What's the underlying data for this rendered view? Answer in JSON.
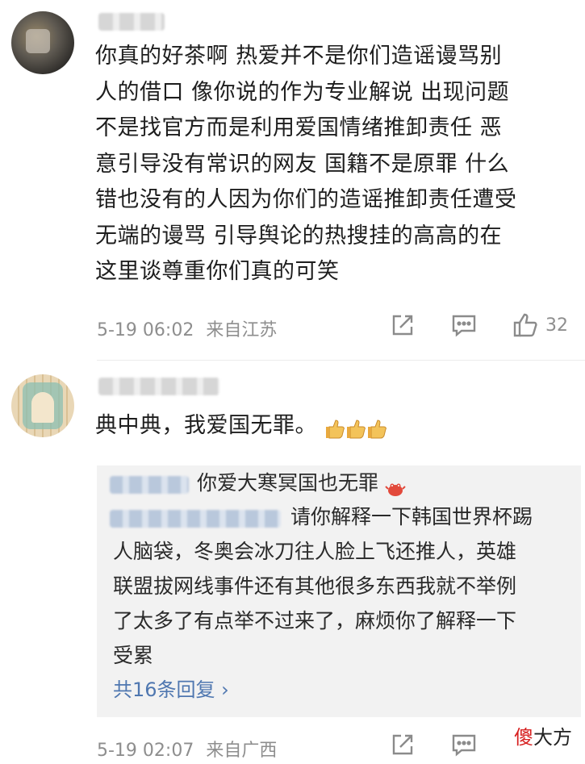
{
  "comments": [
    {
      "text_lines": [
        "你真的好茶啊 热爱并不是你们造谣谩骂别",
        "人的借口 像你说的作为专业解说 出现问题",
        "不是找官方而是利用爱国情绪推卸责任 恶",
        "意引导没有常识的网友 国籍不是原罪 什么",
        "错也没有的人因为你们的造谣推卸责任遭受",
        "无端的谩骂 引导舆论的热搜挂的高高的在",
        "这里谈尊重你们真的可笑"
      ],
      "time": "5-19 06:02",
      "location": "来自江苏",
      "like_count": "32"
    },
    {
      "text": "典中典，我爱国无罪。",
      "emoji": [
        "thumbs-up",
        "thumbs-up",
        "thumbs-up"
      ],
      "time": "5-19 02:07",
      "location": "来自广西",
      "replies": [
        {
          "text": "你爱大寒冥国也无罪",
          "emoji": "crab"
        },
        {
          "text_lines": [
            "请你解释一下韩国世界杯踢",
            "人脑袋，冬奥会冰刀往人脸上飞还推人，英雄",
            "联盟拔网线事件还有其他很多东西我就不举例",
            "了太多了有点举不过来了，麻烦你了解释一下",
            "受累"
          ]
        }
      ],
      "more_replies_label": "共16条回复 ›"
    }
  ],
  "watermark": {
    "red": "傻",
    "black": "大方"
  },
  "colors": {
    "link": "#4f77b0",
    "meta": "#8e8e8e",
    "reply_bg": "#f2f2f2"
  }
}
